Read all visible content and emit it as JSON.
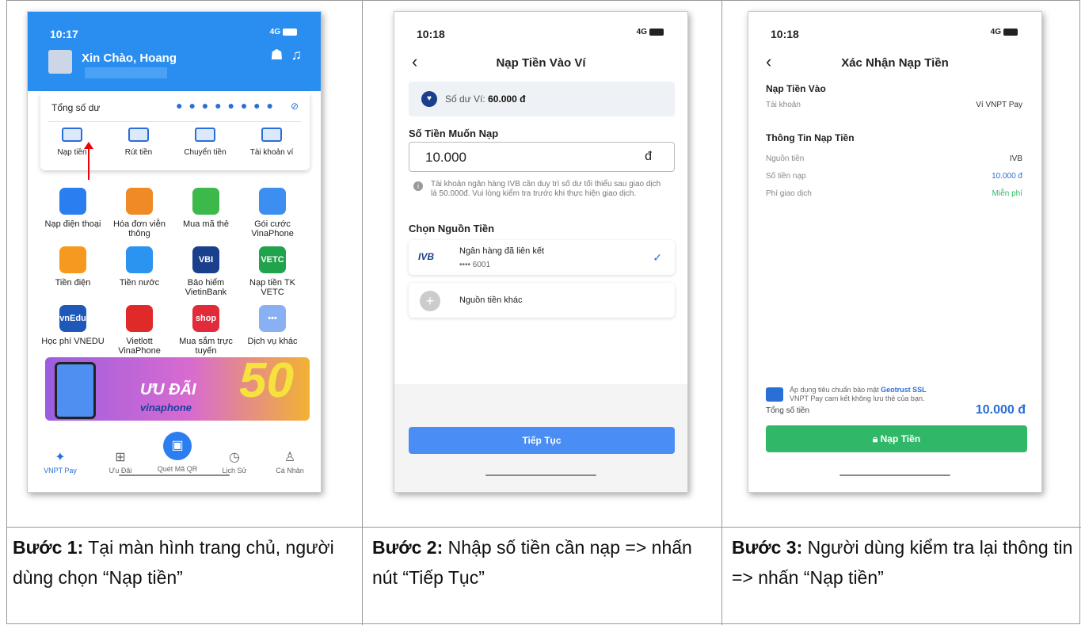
{
  "colors": {
    "blue": "#2a8ef0",
    "accent": "#2a6ed8",
    "green": "#30b868",
    "continue": "#4a8df4",
    "amount_blue": "#2a6ed8"
  },
  "phone1": {
    "time": "10:17",
    "signal": "4G",
    "greeting": "Xin Chào, Hoang",
    "balance_label": "Tổng số dư",
    "balance_masked": "● ● ● ● ● ● ● ●",
    "quick_actions": [
      {
        "label": "Nạp tiền",
        "icon": "deposit-icon"
      },
      {
        "label": "Rút tiền",
        "icon": "withdraw-icon"
      },
      {
        "label": "Chuyển tiền",
        "icon": "transfer-icon"
      },
      {
        "label": "Tài khoản ví",
        "icon": "wallet-account-icon"
      }
    ],
    "services": [
      {
        "label": "Nạp điện thoại",
        "icon": "phone-topup-icon",
        "color": "#2a7ef0"
      },
      {
        "label": "Hóa đơn viễn thông",
        "icon": "telecom-bill-icon",
        "color": "#f08a24"
      },
      {
        "label": "Mua mã thẻ",
        "icon": "card-code-icon",
        "color": "#3cb94a"
      },
      {
        "label": "Gói cước VinaPhone",
        "icon": "vinaphone-icon",
        "color": "#3c8ef0"
      },
      {
        "label": "Tiền điện",
        "icon": "electricity-icon",
        "color": "#f59a1e"
      },
      {
        "label": "Tiền nước",
        "icon": "water-icon",
        "color": "#2b94f0"
      },
      {
        "label": "Bảo hiểm VietinBank",
        "icon": "vbi-insurance-icon",
        "color": "#1a3f8c",
        "text": "VBI"
      },
      {
        "label": "Nạp tiền TK VETC",
        "icon": "vetc-icon",
        "color": "#21a24c",
        "text": "VETC"
      },
      {
        "label": "Học phí VNEDU",
        "icon": "vnedu-icon",
        "color": "#1e58b8",
        "text": "vnEdu"
      },
      {
        "label": "Vietlott VinaPhone",
        "icon": "vietlott-icon",
        "color": "#e02a2a"
      },
      {
        "label": "Mua sắm trực tuyến",
        "icon": "shop-icon",
        "color": "#e22a3a",
        "text": "shop"
      },
      {
        "label": "Dịch vụ khác",
        "icon": "more-services-icon",
        "color": "#8ab0f4",
        "text": "•••"
      }
    ],
    "banner": {
      "title": "ƯU ĐÃI",
      "brand": "vinaphone",
      "big": "50"
    },
    "tabs": [
      {
        "label": "VNPT Pay",
        "icon": "vnpt-pay-icon"
      },
      {
        "label": "Ưu Đãi",
        "icon": "gift-icon"
      },
      {
        "label": "Quét Mã QR",
        "icon": "qr-scan-icon"
      },
      {
        "label": "Lịch Sử",
        "icon": "history-icon"
      },
      {
        "label": "Cá Nhân",
        "icon": "profile-icon"
      }
    ]
  },
  "phone2": {
    "time": "10:18",
    "signal": "4G",
    "title": "Nạp Tiền Vào Ví",
    "wallet_label": "Số dư Ví: ",
    "wallet_balance": "60.000 đ",
    "amount_heading": "Số Tiền Muốn Nạp",
    "amount_value": "10.000",
    "amount_unit": "đ",
    "note": "Tài khoản ngân hàng IVB cần duy trì số dư tối thiểu sau giao dịch là 50.000đ. Vui lòng kiểm tra trước khi thực hiện giao dịch.",
    "source_heading": "Chọn Nguồn Tiền",
    "linked_bank": {
      "logo": "IVB",
      "label": "Ngân hàng đã liên kết",
      "account": "•••• 6001"
    },
    "other_source": "Nguồn tiền khác",
    "continue": "Tiếp Tục"
  },
  "phone3": {
    "time": "10:18",
    "signal": "4G",
    "title": "Xác Nhận Nạp Tiền",
    "to_heading": "Nạp Tiền Vào",
    "account_label": "Tài khoản",
    "account_value": "Ví VNPT Pay",
    "info_heading": "Thông Tin Nạp Tiền",
    "rows": [
      {
        "label": "Nguồn tiền",
        "value": "IVB"
      },
      {
        "label": "Số tiền nạp",
        "value": "10.000 đ"
      },
      {
        "label": "Phí giao dịch",
        "value": "Miễn phí"
      }
    ],
    "ssl_text1": "Áp dụng tiêu chuẩn bảo mật ",
    "ssl_brand": "Geotrust SSL",
    "ssl_text2": "VNPT Pay cam kết không lưu thẻ của bạn.",
    "total_label": "Tổng số tiền",
    "total_value": "10.000 đ",
    "button": "Nạp Tiền"
  },
  "captions": [
    {
      "step": "Bước 1:",
      "text": " Tại màn hình trang chủ, người dùng chọn “Nạp tiền”"
    },
    {
      "step": "Bước 2:",
      "text": " Nhập số tiền cần nạp => nhấn nút “Tiếp Tục”"
    },
    {
      "step": "Bước 3:",
      "text": " Người dùng kiểm tra lại thông tin => nhấn “Nạp tiền”"
    }
  ]
}
